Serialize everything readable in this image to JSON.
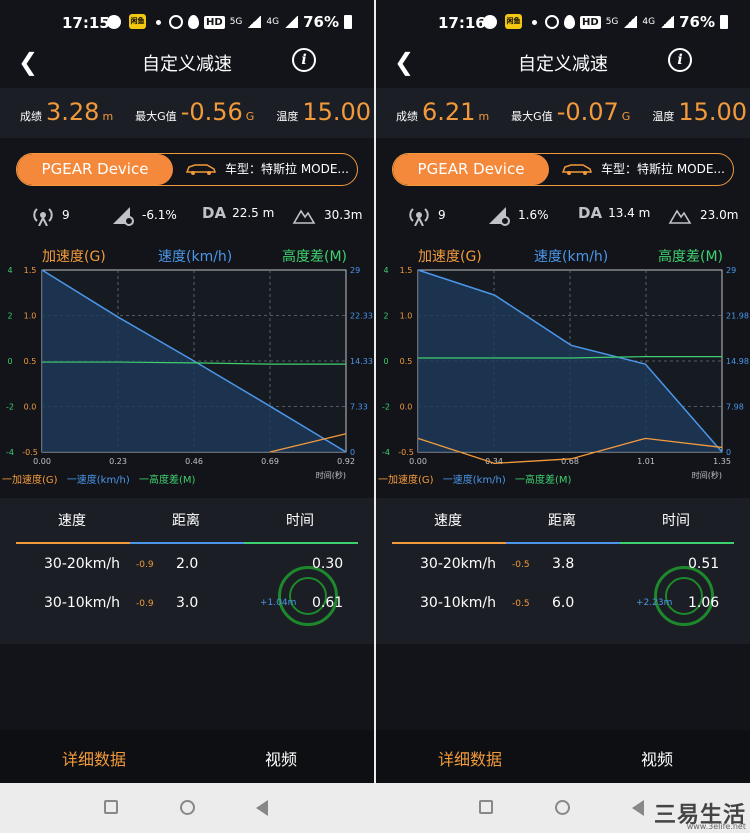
{
  "screens": [
    {
      "status": {
        "time": "17:15",
        "app_badge": "闲鱼",
        "hd": "HD",
        "net1": "5G",
        "net2": "4G",
        "battery": "76%"
      },
      "title": "自定义减速",
      "stats": {
        "score_label": "成绩",
        "score": "3.28",
        "score_unit": "m",
        "g_label": "最大G值",
        "g": "-0.56",
        "g_unit": "G",
        "temp_label": "温度",
        "temp": "15.00",
        "temp_unit": "℃"
      },
      "device": {
        "name": "PGEAR Device",
        "model": "车型：特斯拉 MODE..."
      },
      "metrics": {
        "sats": "9",
        "slope": "-6.1%",
        "da_label": "DA",
        "da": "22.5 m",
        "alt": "30.3m"
      },
      "axes": {
        "accel": "加速度(G)",
        "speed": "速度(km/h)",
        "height": "高度差(M)"
      },
      "chart_ticks": {
        "left_g": [
          "4",
          "2",
          "0",
          "-2",
          "-4"
        ],
        "left_v": [
          "1.5",
          "1.0",
          "0.5",
          "0.0",
          "-0.5"
        ],
        "right": [
          "29",
          "22.33",
          "14.33",
          "7.33",
          "0"
        ],
        "x": [
          "0.00",
          "0.23",
          "0.46",
          "0.69",
          "0.92"
        ],
        "x_label": "时间(秒)"
      },
      "legend": {
        "accel": "一加速度(G)",
        "speed": "一速度(km/h)",
        "height": "一高度差(M)"
      },
      "table": {
        "h_speed": "速度",
        "h_dist": "距离",
        "h_time": "时间",
        "rows": [
          {
            "range": "30-20km/h",
            "g": "-0.9",
            "dist": "2.0",
            "time": "0.30",
            "extra": ""
          },
          {
            "range": "30-10km/h",
            "g": "-0.9",
            "dist": "3.0",
            "time": "0.61",
            "extra": "+1.04m"
          }
        ]
      },
      "tabs": {
        "detail": "详细数据",
        "video": "视频"
      }
    },
    {
      "status": {
        "time": "17:16",
        "app_badge": "闲鱼",
        "hd": "HD",
        "net1": "5G",
        "net2": "4G",
        "battery": "76%"
      },
      "title": "自定义减速",
      "stats": {
        "score_label": "成绩",
        "score": "6.21",
        "score_unit": "m",
        "g_label": "最大G值",
        "g": "-0.07",
        "g_unit": "G",
        "temp_label": "温度",
        "temp": "15.00",
        "temp_unit": "℃"
      },
      "device": {
        "name": "PGEAR Device",
        "model": "车型：特斯拉 MODE..."
      },
      "metrics": {
        "sats": "9",
        "slope": "1.6%",
        "da_label": "DA",
        "da": "13.4 m",
        "alt": "23.0m"
      },
      "axes": {
        "accel": "加速度(G)",
        "speed": "速度(km/h)",
        "height": "高度差(M)"
      },
      "chart_ticks": {
        "left_g": [
          "4",
          "2",
          "0",
          "-2",
          "-4"
        ],
        "left_v": [
          "1.5",
          "1.0",
          "0.5",
          "0.0",
          "-0.5"
        ],
        "right": [
          "29",
          "21.98",
          "14.98",
          "7.98",
          "0"
        ],
        "x": [
          "0.00",
          "0.34",
          "0.68",
          "1.01",
          "1.35"
        ],
        "x_label": "时间(秒)"
      },
      "legend": {
        "accel": "一加速度(G)",
        "speed": "一速度(km/h)",
        "height": "一高度差(M)"
      },
      "table": {
        "h_speed": "速度",
        "h_dist": "距离",
        "h_time": "时间",
        "rows": [
          {
            "range": "30-20km/h",
            "g": "-0.5",
            "dist": "3.8",
            "time": "0.51",
            "extra": ""
          },
          {
            "range": "30-10km/h",
            "g": "-0.5",
            "dist": "6.0",
            "time": "1.06",
            "extra": "+2.23m"
          }
        ]
      },
      "tabs": {
        "detail": "详细数据",
        "video": "视频"
      }
    }
  ],
  "chart_data": [
    {
      "type": "line",
      "x": [
        0,
        0.23,
        0.46,
        0.69,
        0.92
      ],
      "series": [
        {
          "name": "速度(km/h)",
          "values": [
            29,
            21.5,
            14.5,
            7.3,
            0
          ]
        },
        {
          "name": "高度差(M)",
          "values": [
            14.33,
            14.33,
            14.2,
            14.0,
            14.0
          ]
        },
        {
          "name": "加速度(G)",
          "values": [
            null,
            null,
            null,
            -4,
            -3.2
          ]
        }
      ]
    },
    {
      "type": "line",
      "x": [
        0,
        0.34,
        0.68,
        1.01,
        1.35
      ],
      "series": [
        {
          "name": "速度(km/h)",
          "values": [
            29,
            25,
            17,
            14,
            0
          ]
        },
        {
          "name": "高度差(M)",
          "values": [
            14.98,
            14.98,
            14.98,
            15.2,
            15.2
          ]
        },
        {
          "name": "加速度(G)",
          "values": [
            -3.4,
            -4.5,
            -4.3,
            -3.4,
            -3.8
          ]
        }
      ]
    }
  ],
  "watermark": {
    "text": "三易生活",
    "url": "www.3elife.net"
  }
}
